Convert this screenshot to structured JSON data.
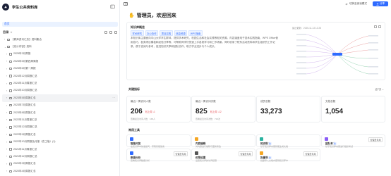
{
  "sidebar": {
    "title": "学生公共资料库",
    "home": "首页",
    "directory_label": "目录",
    "items": [
      {
        "label": "【教师资讯汇总】资料集合",
        "child": false,
        "chevron": "›"
      },
      {
        "label": "【总计内容】资料",
        "child": false,
        "chevron": "⌄"
      },
      {
        "label": "2025年3月周报",
        "child": true,
        "chevron": "›"
      },
      {
        "label": "2025年5月第四周周报",
        "child": true,
        "chevron": "›"
      },
      {
        "label": "2025年6月第一周报",
        "child": true,
        "chevron": "›"
      },
      {
        "label": "2024年12月周报汇总",
        "child": true,
        "chevron": "›"
      },
      {
        "label": "2024年11月周报汇总",
        "child": true,
        "chevron": "›"
      },
      {
        "label": "2024年10月周报汇总",
        "child": true,
        "chevron": "›"
      },
      {
        "label": "2023年5月周报汇总",
        "child": true,
        "chevron": "›",
        "highlight": true,
        "more": "···"
      },
      {
        "label": "2023年7月周报汇总",
        "child": true,
        "chevron": "›"
      },
      {
        "label": "2023年8月周报汇总",
        "child": true,
        "chevron": "›"
      },
      {
        "label": "2022年11月周报汇总",
        "child": true,
        "chevron": "›"
      },
      {
        "label": "2022年12月周报汇总",
        "child": true,
        "chevron": "›"
      },
      {
        "label": "2022年9月周报汇总",
        "child": true,
        "chevron": "›"
      },
      {
        "label": "2022年10月周报及月报（农工版）(1)",
        "child": true,
        "chevron": "›"
      },
      {
        "label": "2021年11月周报汇总",
        "child": true,
        "chevron": "›"
      },
      {
        "label": "2021年12月周报汇总",
        "child": true,
        "chevron": "›"
      },
      {
        "label": "2020年3月周报汇总",
        "child": true,
        "chevron": "›"
      },
      {
        "label": "2020年4月周报汇总",
        "child": true,
        "chevron": "›"
      }
    ]
  },
  "topbar": {
    "mode_label": "切换至阅读模式",
    "share_label": "分享"
  },
  "main": {
    "welcome_icon": "wave-hand-icon",
    "welcome_title": "管理员，欢迎回来",
    "knowledge": {
      "heading": "知识库概览",
      "tags": [
        "学术研究",
        "办公协作",
        "项目实践",
        "信息资源",
        "WPS指南"
      ],
      "description": "本知识库主要面向中山大学学生群体，提供学术研究、校园生活和社会实践等相关资源。内容涵盖电子技术实践指南、WPS Office使用技巧、各类项目模板和经验分享等，可帮助同学们快速上手各类学习和工作场景。同时收录了院系活动资料和学生组织的工作记录，便于查阅与参考，促进知识共享和团队协作，助力学业进步与个人成长。",
      "updated": "最近更新：2025-11-13 12:28"
    },
    "stats_section": {
      "title": "关键指标",
      "range": "近7天 ⌄",
      "cards": [
        {
          "label": "最近一周访问人数",
          "value": "206",
          "delta": "较上周 ↓1",
          "sub": "查看最近访问人数：168人"
        },
        {
          "label": "最近一周访问次数",
          "value": "825",
          "delta": "较上周 ↓12",
          "sub": "查看最近访问次数：716次"
        },
        {
          "label": "成员总数",
          "value": "33,273",
          "delta": "",
          "sub": ""
        },
        {
          "label": "文档总数",
          "value": "1,054",
          "delta": "",
          "sub": ""
        }
      ]
    },
    "tools_section": {
      "title": "常用工具",
      "tools": [
        {
          "name": "智能问答",
          "sub": "在知识库中快速提问，获取智能答案",
          "badge": "",
          "manage": "",
          "color": "#2f6bff"
        },
        {
          "name": "内容编辑",
          "sub": "对内容进行编辑与更新修改",
          "badge": "",
          "manage": "",
          "color": "#f5a623"
        },
        {
          "name": "知识助手",
          "sub": "基于知识库内容智能生成文档",
          "badge": "新",
          "manage": "",
          "color": "#2bb3a0"
        },
        {
          "name": "团队考试",
          "sub": "基于知识库内容进行组织考试",
          "badge": "新",
          "manage": "管理员专用",
          "color": "#8a5cf6"
        },
        {
          "name": "数据分析",
          "sub": "查看知识库数据分析",
          "badge": "",
          "manage": "管理员专用",
          "color": "#2f6bff"
        },
        {
          "name": "权限设置",
          "sub": "设置知识库的访问权限",
          "badge": "",
          "manage": "管理员专用",
          "color": "#555555"
        },
        {
          "name": "批量导入",
          "sub": "批量导入文档内容到知识库中",
          "badge": "新",
          "manage": "管理员专用",
          "color": "#f5a623"
        }
      ]
    }
  }
}
